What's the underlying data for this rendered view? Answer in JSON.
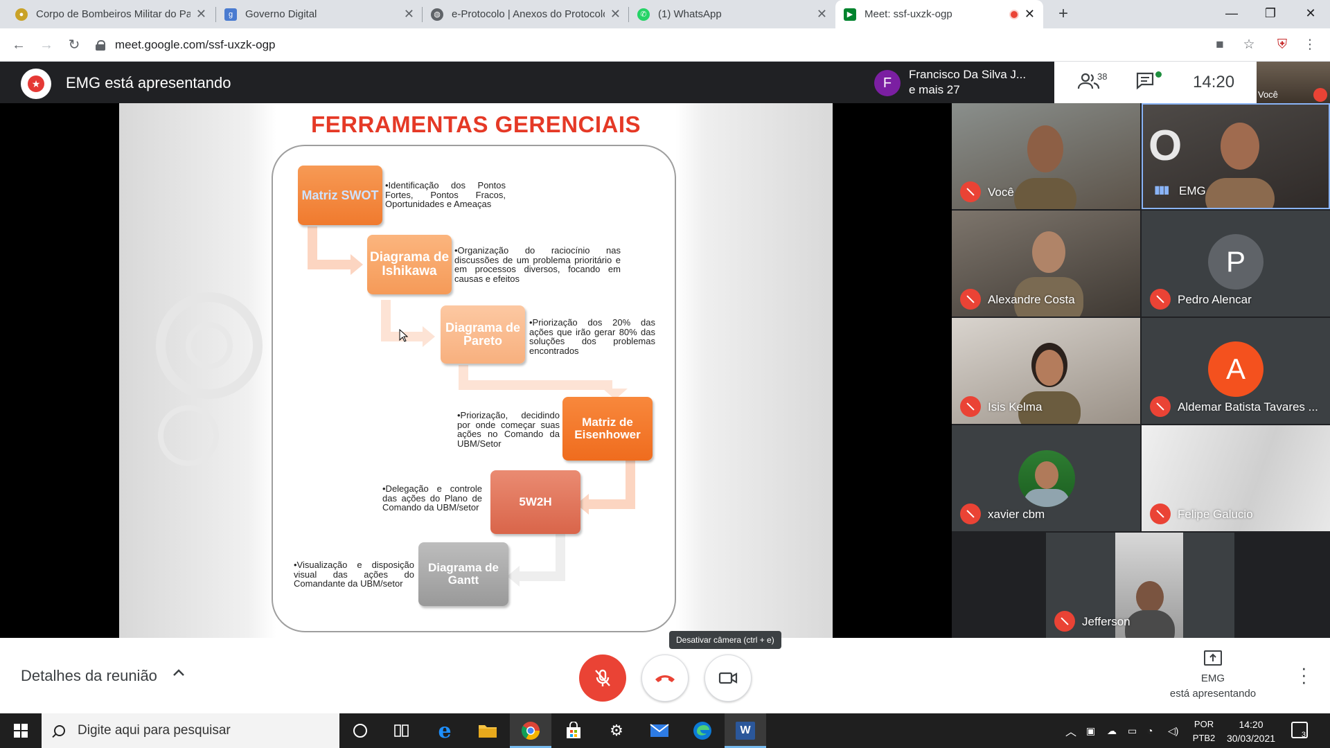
{
  "browser": {
    "tabs": [
      {
        "label": "Corpo de Bombeiros Militar do Pará",
        "favicon": "bombeiros-icon"
      },
      {
        "label": "Governo Digital",
        "favicon": "gov-icon"
      },
      {
        "label": "e-Protocolo | Anexos do Protocolo",
        "favicon": "globe-icon"
      },
      {
        "label": "(1) WhatsApp",
        "favicon": "whatsapp-icon"
      },
      {
        "label": "Meet: ssf-uxzk-ogp",
        "favicon": "meet-icon"
      }
    ],
    "url": "meet.google.com/ssf-uxzk-ogp"
  },
  "meet": {
    "presenter_text": "EMG está apresentando",
    "people_box": {
      "initial": "F",
      "name": "Francisco Da Silva J...",
      "more": "e mais 27"
    },
    "participant_count": "38",
    "time": "14:20",
    "self_label": "Você"
  },
  "slide": {
    "title": "FERRAMENTAS GERENCIAIS",
    "tools": [
      {
        "name": "Matriz SWOT",
        "desc": "•Identificação dos Pontos Fortes, Pontos Fracos, Oportunidades e Ameaças"
      },
      {
        "name": "Diagrama de Ishikawa",
        "desc": "•Organização do raciocínio nas discussões de um problema prioritário e em processos diversos, focando em causas e efeitos"
      },
      {
        "name": "Diagrama de Pareto",
        "desc": "•Priorização dos 20% das ações que irão gerar 80% das soluções dos problemas encontrados"
      },
      {
        "name": "Matriz de Eisenhower",
        "desc": "•Priorização, decidindo por onde começar suas ações no Comando da UBM/Setor"
      },
      {
        "name": "5W2H",
        "desc": "•Delegação e controle das ações do Plano de Comando da UBM/setor"
      },
      {
        "name": "Diagrama de Gantt",
        "desc": "•Visualização e disposição visual das ações do Comandante da UBM/setor"
      }
    ]
  },
  "participants": [
    {
      "name": "Você",
      "muted": true
    },
    {
      "name": "EMG",
      "muted": false
    },
    {
      "name": "Alexandre Costa",
      "muted": true
    },
    {
      "name": "Pedro Alencar",
      "muted": true,
      "initial": "P"
    },
    {
      "name": "Isis Kelma",
      "muted": true
    },
    {
      "name": "Aldemar Batista Tavares ...",
      "muted": true,
      "initial": "A"
    },
    {
      "name": "xavier cbm",
      "muted": true
    },
    {
      "name": "Felipe Galucio",
      "muted": true
    },
    {
      "name": "Jefferson",
      "muted": true
    }
  ],
  "controls": {
    "details_label": "Detalhes da reunião",
    "tooltip": "Desativar câmera (ctrl + e)",
    "presenting_line1": "EMG",
    "presenting_line2": "está apresentando"
  },
  "taskbar": {
    "search_placeholder": "Digite aqui para pesquisar",
    "lang_line1": "POR",
    "lang_line2": "PTB2",
    "time": "14:20",
    "date": "30/03/2021",
    "notifications": "3"
  },
  "colors": {
    "slide_title": "#e53926",
    "box_orange": "#f47c30",
    "box_light": "#f8a86a",
    "box_red": "#e2664c",
    "box_gray": "#a6a6a6",
    "mute_red": "#ea4335"
  }
}
